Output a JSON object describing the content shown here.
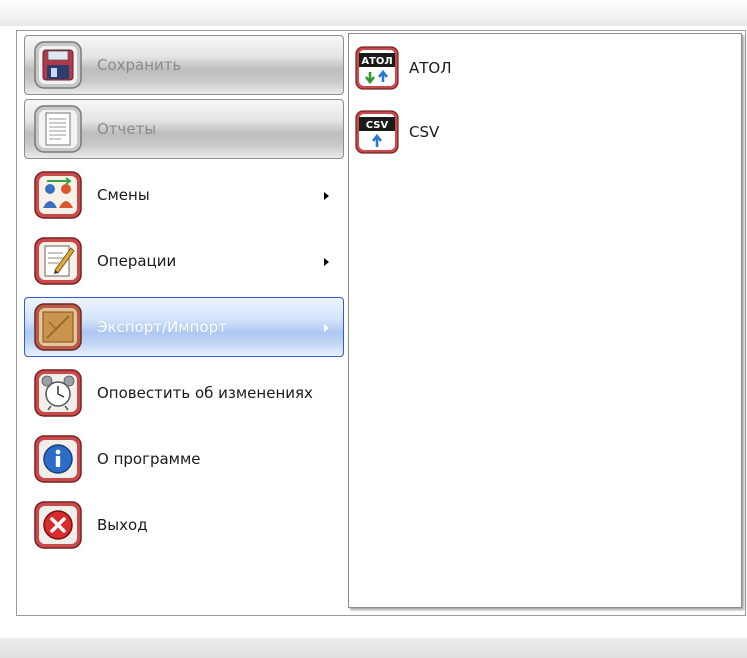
{
  "menu": {
    "items": [
      {
        "label": "Сохранить",
        "icon": "floppy-disk-icon",
        "state": "disabled",
        "submenu": false
      },
      {
        "label": "Отчеты",
        "icon": "report-document-icon",
        "state": "disabled",
        "submenu": false
      },
      {
        "label": "Смены",
        "icon": "shift-people-icon",
        "state": "normal",
        "submenu": true
      },
      {
        "label": "Операции",
        "icon": "operations-clipboard-icon",
        "state": "normal",
        "submenu": true
      },
      {
        "label": "Экспорт/Импорт",
        "icon": "export-import-icon",
        "state": "selected",
        "submenu": true
      },
      {
        "label": "Оповестить об изменениях",
        "icon": "alarm-clock-icon",
        "state": "normal",
        "submenu": false
      },
      {
        "label": "О программе",
        "icon": "info-icon",
        "state": "normal",
        "submenu": false
      },
      {
        "label": "Выход",
        "icon": "exit-icon",
        "state": "normal",
        "submenu": false
      }
    ]
  },
  "submenu": {
    "items": [
      {
        "label": "АТОЛ",
        "icon": "atol-icon",
        "icon_text": "АТОЛ"
      },
      {
        "label": "CSV",
        "icon": "csv-icon",
        "icon_text": "CSV"
      }
    ]
  },
  "colors": {
    "selection_border": "#2f5dd6",
    "selection_fill": "#aec8f2",
    "disabled_text": "#8a8a8a",
    "icon_frame_red": "#b63c3c"
  }
}
